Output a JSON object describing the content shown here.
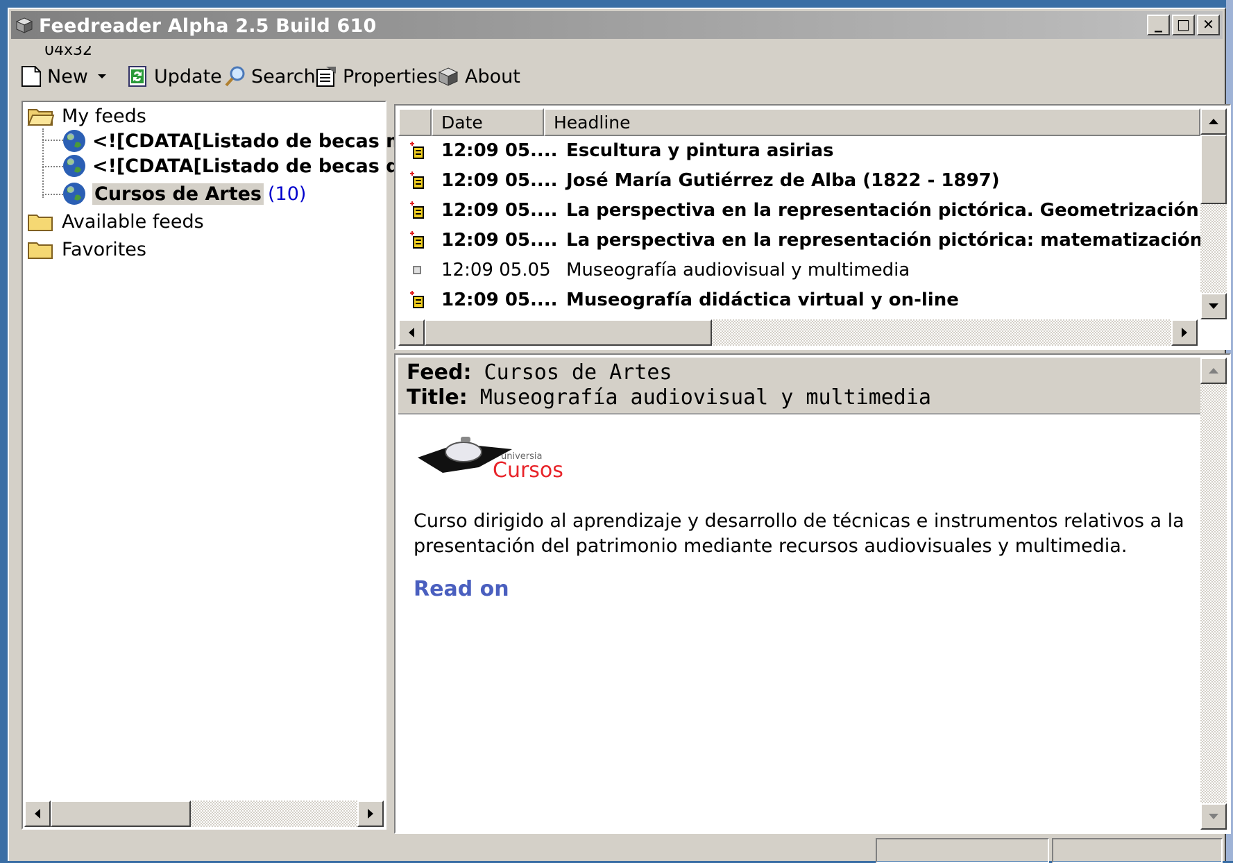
{
  "window": {
    "title": "Feedreader Alpha 2.5 Build 610",
    "min_label": "_",
    "max_label": "□",
    "close_label": "✕"
  },
  "toolbar": {
    "overlap_text": "04x32",
    "new_label": "New",
    "update_label": "Update",
    "search_label": "Search",
    "properties_label": "Properties",
    "about_label": "About"
  },
  "tree": {
    "my_feeds": "My feeds",
    "feeds": [
      {
        "label": "<![CDATA[Listado de becas m"
      },
      {
        "label": "<![CDATA[Listado de becas d"
      },
      {
        "label": "Cursos de Artes",
        "count": "(10)"
      }
    ],
    "available_feeds": "Available feeds",
    "favorites": "Favorites"
  },
  "list": {
    "columns": [
      "Date",
      "Headline"
    ],
    "rows": [
      {
        "date": "12:09 05....",
        "headline": "Escultura y pintura asirias",
        "unread": true
      },
      {
        "date": "12:09 05....",
        "headline": "José María Gutiérrez de Alba (1822 - 1897)",
        "unread": true
      },
      {
        "date": "12:09 05....",
        "headline": "La perspectiva en la representación pictórica. Geometrización ru",
        "unread": true
      },
      {
        "date": "12:09 05....",
        "headline": "La perspectiva en la representación pictórica: matematización d",
        "unread": true
      },
      {
        "date": "12:09 05.05",
        "headline": "Museografía audiovisual y multimedia",
        "unread": false
      },
      {
        "date": "12:09 05....",
        "headline": "Museografía didáctica virtual y on-line",
        "unread": true
      }
    ]
  },
  "preview": {
    "feed_label": "Feed:",
    "feed_value": "Cursos de Artes",
    "title_label": "Title:",
    "title_value": "Museografía audiovisual y multimedia",
    "logo_small": "universia",
    "logo_big": "Cursos",
    "body": "Curso dirigido al aprendizaje y desarrollo de técnicas e instrumentos relativos a la presentación del patrimonio mediante recursos audiovisuales y multimedia.",
    "read_on": "Read on"
  },
  "colors": {
    "accent_link": "#4a5fbf",
    "count": "#0000cc",
    "logo_red": "#e8242a"
  }
}
